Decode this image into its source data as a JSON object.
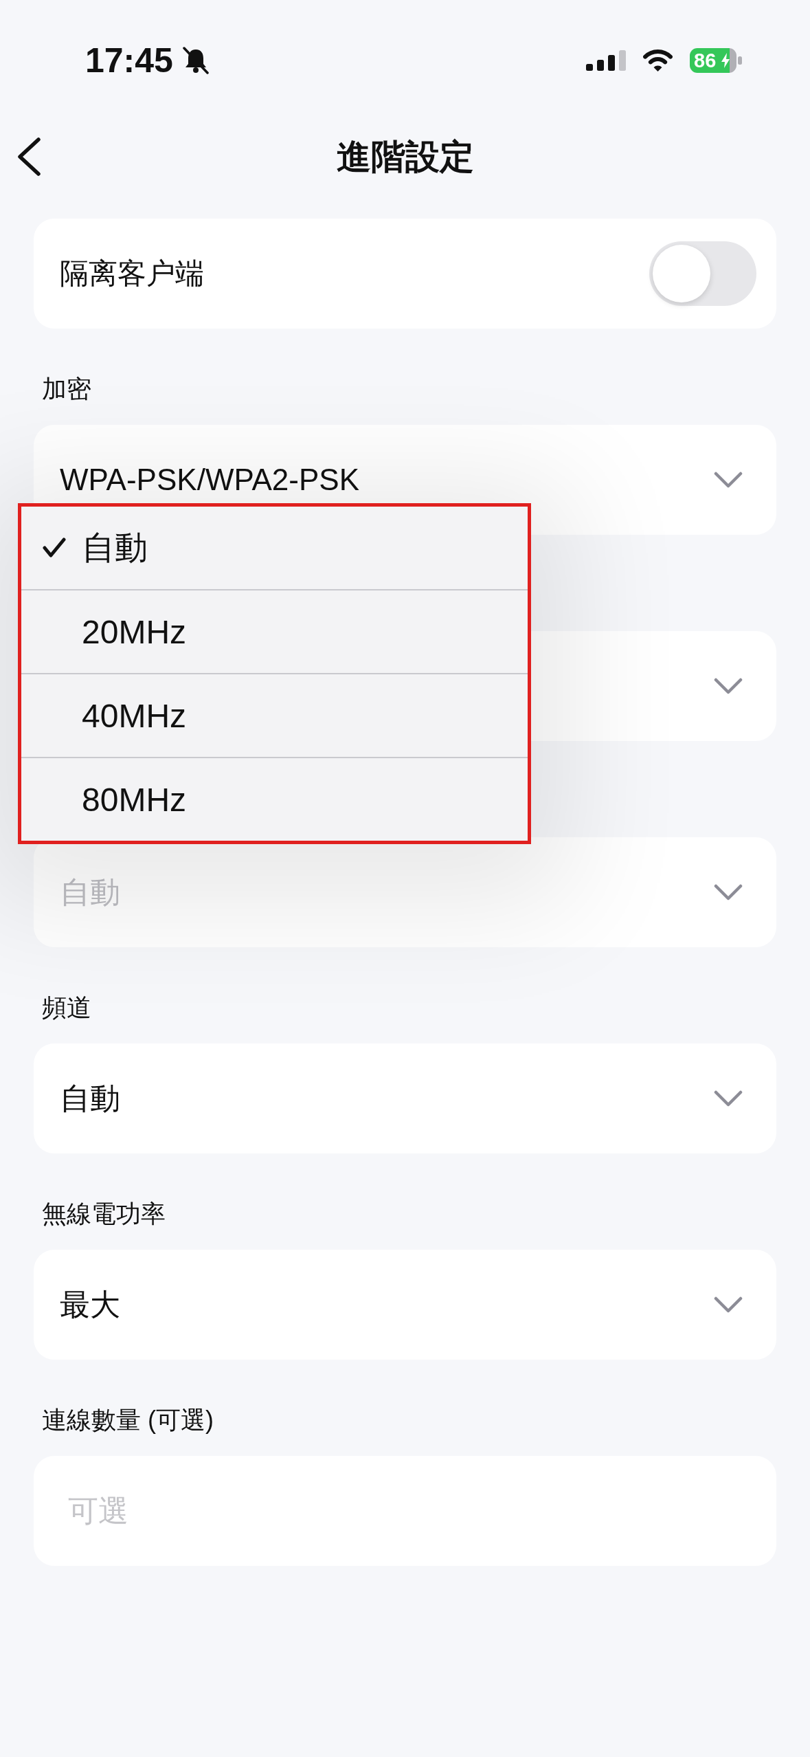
{
  "status_bar": {
    "time": "17:45",
    "battery": "86"
  },
  "nav": {
    "title": "進階設定"
  },
  "settings": [
    {
      "kind": "toggle",
      "label": "隔离客户端",
      "on": false
    },
    {
      "kind": "select",
      "caption": "加密",
      "value": "WPA-PSK/WPA2-PSK",
      "disabled": false
    },
    {
      "kind": "select"
    },
    {
      "kind": "select",
      "value": "自動",
      "disabled": true
    },
    {
      "kind": "select",
      "caption": "頻道",
      "value": "自動",
      "disabled": false
    },
    {
      "kind": "select",
      "caption": "無線電功率",
      "value": "最大",
      "disabled": false
    },
    {
      "kind": "input",
      "caption": "連線數量 (可選)",
      "placeholder": "可選"
    }
  ],
  "dropdown": {
    "options": [
      {
        "label": "自動",
        "selected": true
      },
      {
        "label": "20MHz",
        "selected": false
      },
      {
        "label": "40MHz",
        "selected": false
      },
      {
        "label": "80MHz",
        "selected": false
      }
    ]
  }
}
